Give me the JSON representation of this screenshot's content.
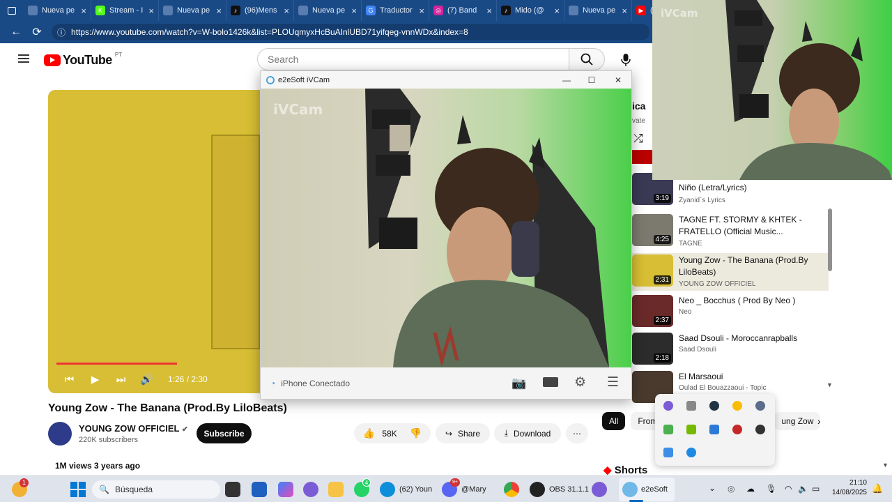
{
  "tabs": [
    {
      "label": "Nueva pe",
      "color": "#5a7db0"
    },
    {
      "label": "Stream - I",
      "color": "#53fc18",
      "glyph": "K"
    },
    {
      "label": "Nueva pe",
      "color": "#5a7db0"
    },
    {
      "label": "(96)Mens",
      "color": "#111111",
      "glyph": "♪"
    },
    {
      "label": "Nueva pe",
      "color": "#5a7db0"
    },
    {
      "label": "Traductor",
      "color": "#4285f4",
      "glyph": "G"
    },
    {
      "label": "(7) Band",
      "color": "#d6249f",
      "glyph": "◎"
    },
    {
      "label": "Mido (@",
      "color": "#111111",
      "glyph": "♪"
    },
    {
      "label": "Nueva pe",
      "color": "#5a7db0"
    },
    {
      "label": "(",
      "color": "#ff0000",
      "glyph": "▶"
    }
  ],
  "address": {
    "url": "https://www.youtube.com/watch?v=W-bolo1426k&list=PLOUqmyxHcBuAInlUBD71yifqeg-vnnWDx&index=8"
  },
  "youtube": {
    "logo_word": "YouTube",
    "country": "PT",
    "search_placeholder": "Search",
    "video": {
      "time": "1:26 / 2:30",
      "progress": 0.57
    },
    "title": "Young Zow - The Banana (Prod.By LiloBeats)",
    "channel": {
      "name": "YOUNG ZOW OFFICIEL",
      "subs": "220K subscribers",
      "subscribe": "Subscribe"
    },
    "actions": {
      "likes": "58K",
      "share": "Share",
      "download": "Download",
      "more": "⋯"
    },
    "meta": "1M views  3 years ago"
  },
  "playlist": {
    "header_partial": "ica",
    "header_sub": "vate",
    "items": [
      {
        "title": "Niño (Letra/Lyrics)",
        "channel": "Zyanid`s Lyrics",
        "duration": "3:19",
        "thumb": "#3b3a55"
      },
      {
        "title": "TAGNE FT. STORMY & KHTEK - FRATELLO (Official Music...",
        "channel": "TAGNE",
        "duration": "4:25",
        "thumb": "#7c7a6e"
      },
      {
        "title": "Young Zow - The Banana (Prod.By LiloBeats)",
        "channel": "YOUNG ZOW OFFICIEL",
        "duration": "2:31",
        "thumb": "#d8be34",
        "active": true
      },
      {
        "title": "Neo _ Bocchus ( Prod By Neo )",
        "channel": "Neo",
        "duration": "2:37",
        "thumb": "#6a2a2a"
      },
      {
        "title": "Saad Dsouli - Moroccanrapballs",
        "channel": "Saad Dsouli",
        "duration": "2:18",
        "thumb": "#2c2c2c"
      },
      {
        "title": "El Marsaoui",
        "channel": "Oulad El Bouazzaoui - Topic",
        "duration": "",
        "thumb": "#4a3a2e"
      }
    ]
  },
  "chips": [
    "All",
    "From",
    "ung Zow"
  ],
  "shorts": "Shorts",
  "ivcam": {
    "title": "e2eSoft iVCam",
    "watermark": "iVCam",
    "status": "iPhone Conectado"
  },
  "taskbar": {
    "search": "Búsqueda",
    "weather_badge": "1",
    "whatsapp_badge": "4",
    "discord_badge": "9+",
    "edge_label": "(62) Youn",
    "discord_label": "@Mary",
    "obs_label": "OBS 31.1.1",
    "ivcam_label": "e2eSoft",
    "time": "21:10",
    "date": "14/08/2025"
  },
  "colors": {
    "tabbar": "#1a4a86",
    "yt_red": "#ff0000",
    "video_yellow": "#d8be34",
    "green_screen": "#3ecf45"
  }
}
